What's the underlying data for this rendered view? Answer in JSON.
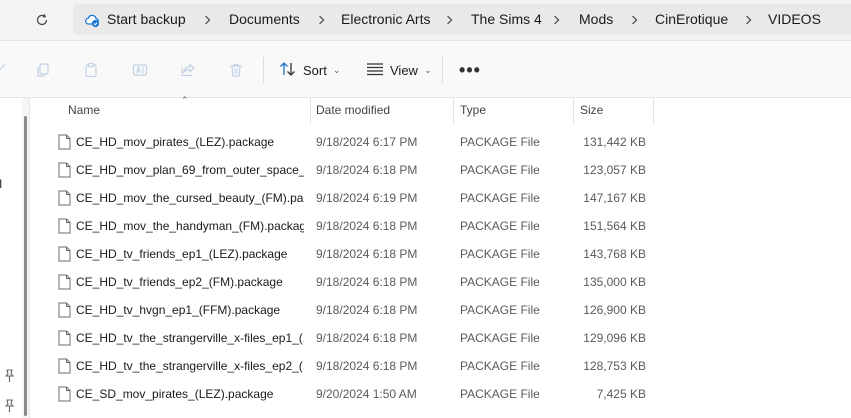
{
  "address_bar": {
    "backup_label": "Start backup",
    "breadcrumbs": [
      "Documents",
      "Electronic Arts",
      "The Sims 4",
      "Mods",
      "CinErotique",
      "VIDEOS"
    ]
  },
  "toolbar": {
    "sort_label": "Sort",
    "view_label": "View",
    "more_label": "•••"
  },
  "nav_pane": {
    "truncated_labels": [
      "nal",
      "s"
    ]
  },
  "columns": {
    "name": "Name",
    "date": "Date modified",
    "type": "Type",
    "size": "Size"
  },
  "files": [
    {
      "name": "CE_HD_mov_pirates_(LEZ).package",
      "date": "9/18/2024 6:17 PM",
      "type": "PACKAGE File",
      "size": "131,442 KB"
    },
    {
      "name": "CE_HD_mov_plan_69_from_outer_space_...",
      "date": "9/18/2024 6:18 PM",
      "type": "PACKAGE File",
      "size": "123,057 KB"
    },
    {
      "name": "CE_HD_mov_the_cursed_beauty_(FM).pa...",
      "date": "9/18/2024 6:19 PM",
      "type": "PACKAGE File",
      "size": "147,167 KB"
    },
    {
      "name": "CE_HD_mov_the_handyman_(FM).package",
      "date": "9/18/2024 6:18 PM",
      "type": "PACKAGE File",
      "size": "151,564 KB"
    },
    {
      "name": "CE_HD_tv_friends_ep1_(LEZ).package",
      "date": "9/18/2024 6:18 PM",
      "type": "PACKAGE File",
      "size": "143,768 KB"
    },
    {
      "name": "CE_HD_tv_friends_ep2_(FM).package",
      "date": "9/18/2024 6:18 PM",
      "type": "PACKAGE File",
      "size": "135,000 KB"
    },
    {
      "name": "CE_HD_tv_hvgn_ep1_(FFM).package",
      "date": "9/18/2024 6:18 PM",
      "type": "PACKAGE File",
      "size": "126,900 KB"
    },
    {
      "name": "CE_HD_tv_the_strangerville_x-files_ep1_(...",
      "date": "9/18/2024 6:18 PM",
      "type": "PACKAGE File",
      "size": "129,096 KB"
    },
    {
      "name": "CE_HD_tv_the_strangerville_x-files_ep2_(...",
      "date": "9/18/2024 6:18 PM",
      "type": "PACKAGE File",
      "size": "128,753 KB"
    },
    {
      "name": "CE_SD_mov_pirates_(LEZ).package",
      "date": "9/20/2024 1:50 AM",
      "type": "PACKAGE File",
      "size": "7,425 KB"
    }
  ]
}
